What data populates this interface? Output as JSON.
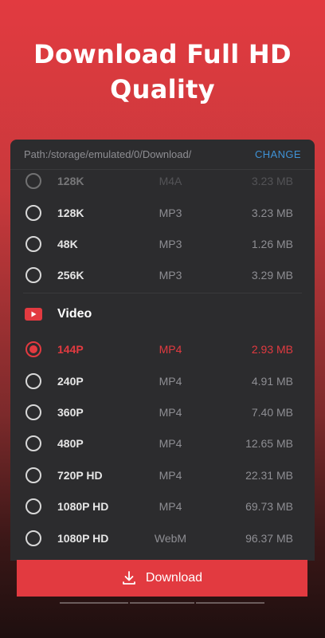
{
  "headline": "Download Full HD Quality",
  "path_bar": {
    "path": "Path:/storage/emulated/0/Download/",
    "change_label": "CHANGE"
  },
  "audio_options": [
    {
      "quality": "128K",
      "format": "M4A",
      "size": "3.23 MB",
      "selected": false
    },
    {
      "quality": "128K",
      "format": "MP3",
      "size": "3.23 MB",
      "selected": false
    },
    {
      "quality": "48K",
      "format": "MP3",
      "size": "1.26 MB",
      "selected": false
    },
    {
      "quality": "256K",
      "format": "MP3",
      "size": "3.29 MB",
      "selected": false
    }
  ],
  "video_section": {
    "label": "Video",
    "icon": "youtube-icon"
  },
  "video_options": [
    {
      "quality": "144P",
      "format": "MP4",
      "size": "2.93 MB",
      "selected": true
    },
    {
      "quality": "240P",
      "format": "MP4",
      "size": "4.91 MB",
      "selected": false
    },
    {
      "quality": "360P",
      "format": "MP4",
      "size": "7.40 MB",
      "selected": false
    },
    {
      "quality": "480P",
      "format": "MP4",
      "size": "12.65 MB",
      "selected": false
    },
    {
      "quality": "720P HD",
      "format": "MP4",
      "size": "22.31 MB",
      "selected": false
    },
    {
      "quality": "1080P HD",
      "format": "MP4",
      "size": "69.73 MB",
      "selected": false
    },
    {
      "quality": "1080P HD",
      "format": "WebM",
      "size": "96.37 MB",
      "selected": false
    }
  ],
  "download_button": {
    "label": "Download",
    "icon": "download-icon"
  },
  "colors": {
    "accent": "#e23a40",
    "panel": "#2c2c2e",
    "link": "#3f92d6"
  }
}
